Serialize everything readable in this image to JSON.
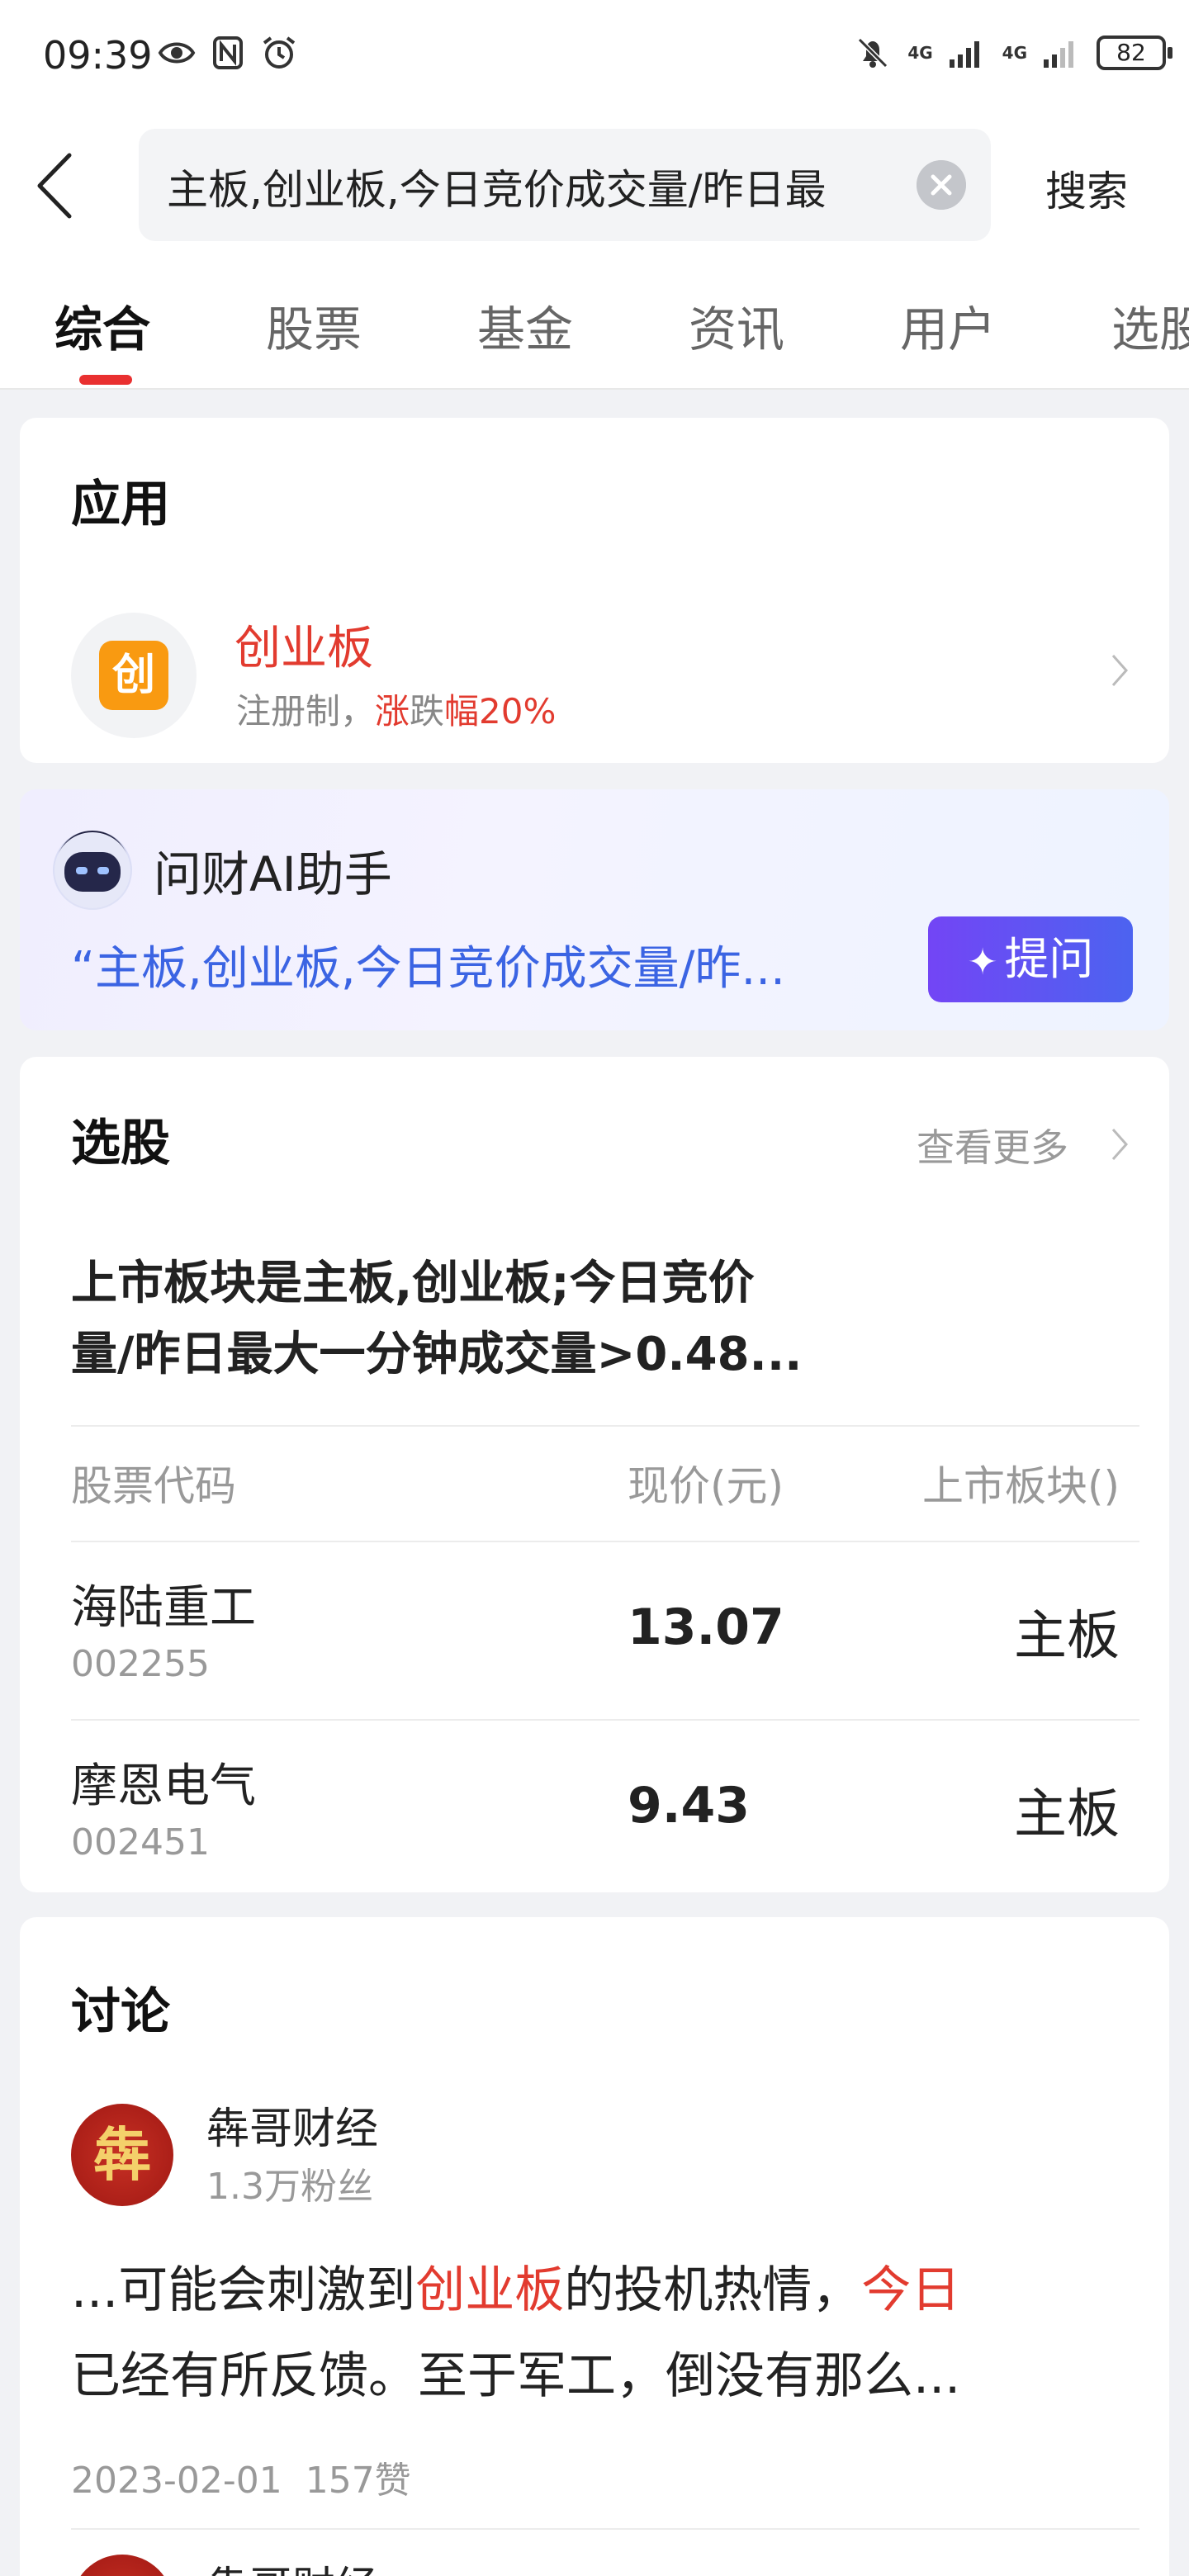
{
  "status_bar": {
    "time": "09:39",
    "battery": "82",
    "net1": "4G",
    "net2": "4G"
  },
  "search": {
    "query": "主板,创业板,今日竞价成交量/昨日最",
    "button_label": "搜索"
  },
  "tabs": [
    {
      "label": "综合",
      "active": true
    },
    {
      "label": "股票",
      "active": false
    },
    {
      "label": "基金",
      "active": false
    },
    {
      "label": "资讯",
      "active": false
    },
    {
      "label": "用户",
      "active": false
    },
    {
      "label": "选股",
      "active": false
    }
  ],
  "app_section": {
    "title": "应用",
    "app": {
      "icon_char": "创",
      "name": "创业板",
      "desc_prefix": "注册制，",
      "desc_red": "涨",
      "desc_mid": "跌",
      "desc_suffix": "幅20%"
    }
  },
  "ai_assistant": {
    "name": "问财AI助手",
    "question": "“主板,创业板,今日竞价成交量/昨...",
    "ask_label": "提问",
    "ask_icon": "✦"
  },
  "stock_pick": {
    "title": "选股",
    "more_label": "查看更多",
    "query_line1": "上市板块是主板,创业板;今日竞价",
    "query_line2": "量/昨日最大一分钟成交量>0.48...",
    "columns": [
      "股票代码",
      "现价(元)",
      "上市板块()"
    ],
    "rows": [
      {
        "name": "海陆重工",
        "code": "002255",
        "price": "13.07",
        "board": "主板"
      },
      {
        "name": "摩恩电气",
        "code": "002451",
        "price": "9.43",
        "board": "主板"
      }
    ]
  },
  "discussion": {
    "title": "讨论",
    "posts": [
      {
        "author": "犇哥财经",
        "avatar_char": "犇",
        "fans": "1.3万粉丝",
        "text_a": "...可能会刺激到",
        "text_hl1": "创业板",
        "text_b": "的投机热情，",
        "text_hl2": "今日",
        "text_c": "已经有所反馈。至于军工，倒没有那么...",
        "date": "2023-02-01",
        "likes": "157赞"
      }
    ],
    "next_author": "犇哥财经"
  },
  "colors": {
    "accent_red": "#e23b2f",
    "link_blue": "#3b64e3",
    "ask_gradient_start": "#7345f5",
    "ask_gradient_end": "#4c63f0",
    "app_icon_orange": "#f99a11"
  }
}
